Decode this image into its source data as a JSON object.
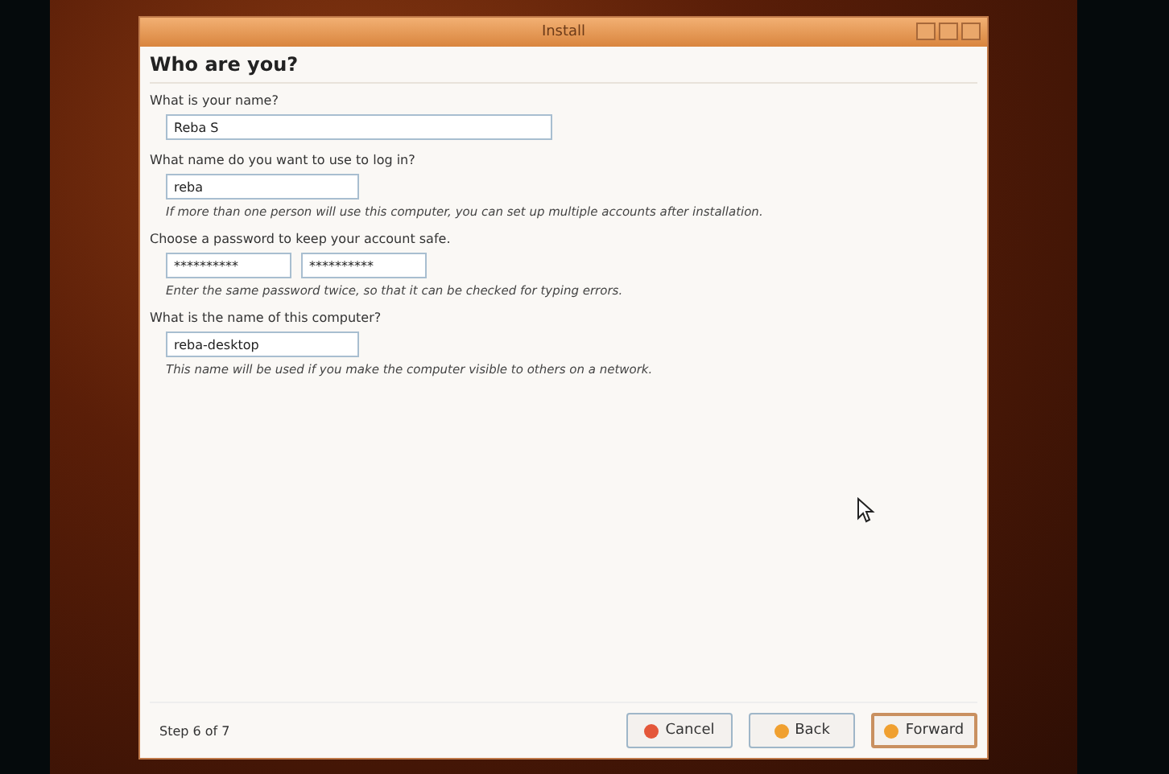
{
  "window": {
    "title": "Install"
  },
  "heading": "Who are you?",
  "sections": [
    {
      "label": "What is your name?",
      "fields": [
        {
          "value": "Reba S",
          "kind": "wide"
        }
      ]
    },
    {
      "label": "What name do you want to use to log in?",
      "fields": [
        {
          "value": "reba",
          "kind": "medium"
        }
      ],
      "hint": "If more than one person will use this computer, you can set up multiple accounts after installation."
    },
    {
      "label": "Choose a password to keep your account safe.",
      "fields": [
        {
          "value": "**********",
          "kind": "short"
        },
        {
          "value": "**********",
          "kind": "short"
        }
      ],
      "hint": "Enter the same password twice, so that it can be checked for typing errors."
    },
    {
      "label": "What is the name of this computer?",
      "fields": [
        {
          "value": "reba-desktop",
          "kind": "medium"
        }
      ],
      "hint": "This name will be used if you make the computer visible to others on a network."
    }
  ],
  "step": "Step 6 of 7",
  "buttons": [
    {
      "label": "Cancel",
      "kind": "cancel",
      "focused": false
    },
    {
      "label": "Back",
      "kind": "back",
      "focused": false
    },
    {
      "label": "Forward",
      "kind": "forward",
      "focused": true
    }
  ]
}
